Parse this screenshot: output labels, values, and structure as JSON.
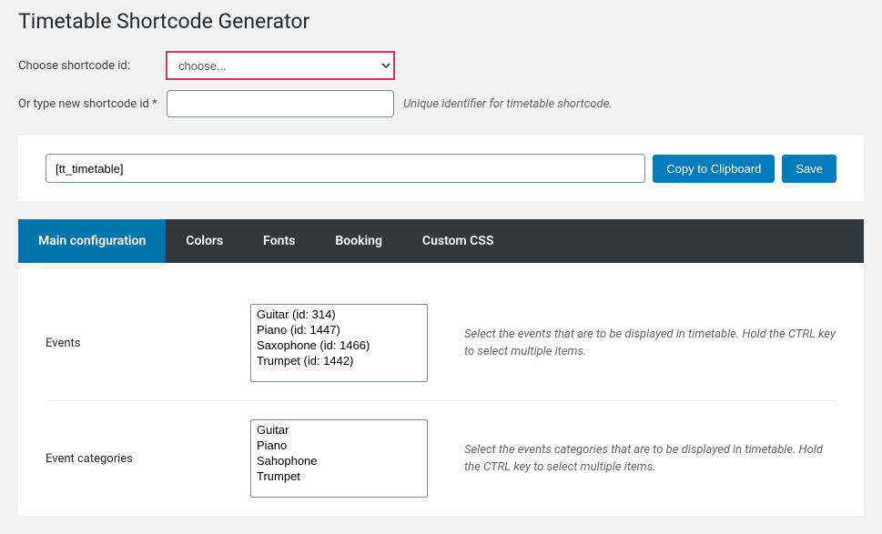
{
  "header": {
    "title": "Timetable Shortcode Generator"
  },
  "form": {
    "choose_label": "Choose shortcode id:",
    "choose_placeholder": "choose...",
    "new_label": "Or type new shortcode id *",
    "new_hint": "Unique identifier for timetable shortcode."
  },
  "shortcode_bar": {
    "value": "[tt_timetable]",
    "copy_label": "Copy to Clipboard",
    "save_label": "Save"
  },
  "tabs": [
    {
      "label": "Main configuration",
      "active": true
    },
    {
      "label": "Colors",
      "active": false
    },
    {
      "label": "Fonts",
      "active": false
    },
    {
      "label": "Booking",
      "active": false
    },
    {
      "label": "Custom CSS",
      "active": false
    }
  ],
  "panel": {
    "events": {
      "label": "Events",
      "options": [
        "Guitar (id: 314)",
        "Piano (id: 1447)",
        "Saxophone (id: 1466)",
        "Trumpet (id: 1442)"
      ],
      "desc": "Select the events that are to be displayed in timetable. Hold the CTRL key to select multiple items."
    },
    "categories": {
      "label": "Event categories",
      "options": [
        "Guitar",
        "Piano",
        "Sahophone",
        "Trumpet"
      ],
      "desc": "Select the events categories that are to be displayed in timetable. Hold the CTRL key to select multiple items."
    }
  }
}
